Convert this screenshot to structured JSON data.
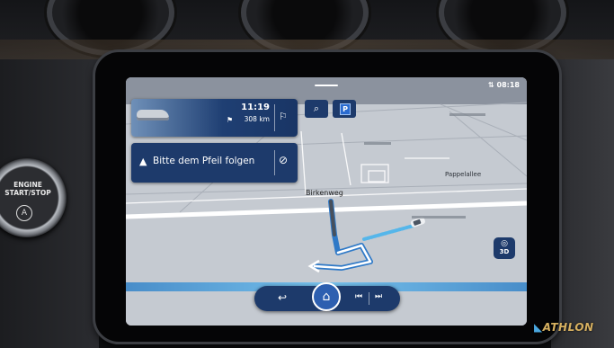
{
  "status_bar": {
    "signal_icon": "signal-icon",
    "time": "08:18"
  },
  "route_card": {
    "arrival_time": "11:19",
    "distance": "308 km",
    "icons": [
      "flag-icon",
      "destination-flag-icon"
    ]
  },
  "guidance": {
    "instruction": "Bitte dem Pfeil folgen",
    "icons": [
      "direction-arrow-icon",
      "mute-icon"
    ]
  },
  "map": {
    "street_label": "Birkenweg",
    "street_label_2": "Pappelallee"
  },
  "map_buttons": {
    "parking": "P",
    "view_3d": "3D",
    "icons": [
      "search-icon",
      "compass-icon"
    ]
  },
  "bottom_bar": {
    "icons": [
      "back-icon",
      "home-icon",
      "previous-icon",
      "next-icon"
    ]
  },
  "console": {
    "engine_button_line1": "ENGINE",
    "engine_button_line2": "START/STOP"
  },
  "watermark": {
    "text": "ATHLON"
  },
  "colors": {
    "panel_blue": "#1d3a6b",
    "route_blue": "#6ec0ef",
    "map_bg": "#c7ccd3"
  }
}
